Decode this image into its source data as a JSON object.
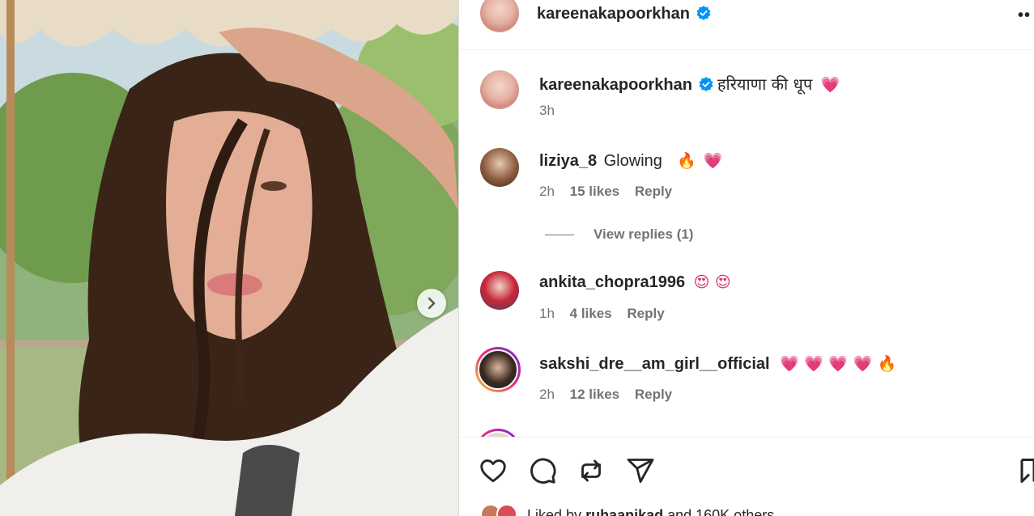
{
  "post": {
    "author": "kareenakapoorkhan",
    "caption": "हरियाणा की धूप",
    "caption_emoji": "💗",
    "time": "3h",
    "more_label": "••"
  },
  "comments": [
    {
      "username": "liziya_8",
      "text": "Glowing",
      "emojis": [
        "🔥",
        "💗"
      ],
      "time": "2h",
      "likes": "15 likes",
      "reply": "Reply",
      "view_replies": "View replies (1)"
    },
    {
      "username": "ankita_chopra1996",
      "text": "",
      "emojis": [
        "😍",
        "😍"
      ],
      "time": "1h",
      "likes": "4 likes",
      "reply": "Reply"
    },
    {
      "username": "sakshi_dre__am_girl__official",
      "text": "",
      "emojis": [
        "💗",
        "💗",
        "💗",
        "💗",
        "🔥"
      ],
      "time": "2h",
      "likes": "12 likes",
      "reply": "Reply"
    }
  ],
  "liked_by": {
    "prefix": "Liked by",
    "user": "ruhaanikad",
    "suffix": "and 160K others"
  },
  "icons": {
    "like": "heart-icon",
    "comment": "comment-icon",
    "share": "repost-icon",
    "send": "send-icon",
    "save": "bookmark-icon",
    "next": "chevron-right-icon",
    "verified": "verified-badge-icon"
  },
  "colors": {
    "verified": "#0095f6",
    "text": "#262626",
    "secondary": "#737373"
  }
}
